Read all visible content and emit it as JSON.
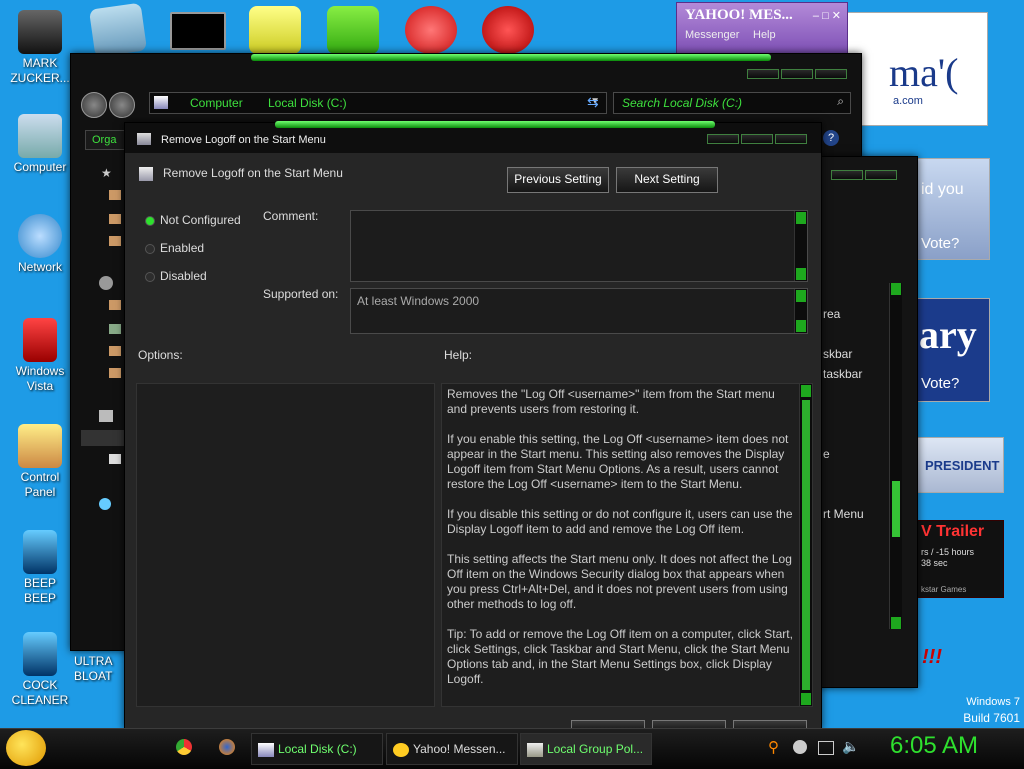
{
  "desktop": {
    "icons": [
      "MARK\nZUCKER...",
      "Computer",
      "Network",
      "Windows\nVista",
      "Control\nPanel",
      "BEEP\nBEEP",
      "COCK\nCLEANER"
    ],
    "partial_icon": "ULTRA\nBLOAT",
    "watermark": {
      "line1": "Windows 7",
      "line2": "Build 7601"
    }
  },
  "ads": {
    "obama": "ma'(",
    "obama_small": "a.com",
    "did_you": "id you",
    "vote1": "Vote?",
    "hillary": "ary",
    "vote2": "Vote?",
    "president": "PRESIDENT",
    "trailer": "V Trailer",
    "trailer_sub1": "rs / -15 hours",
    "trailer_sub2": "38 sec",
    "trailer_sub3": "kstar Games",
    "bangs": "!!!"
  },
  "yahoo": {
    "title": "YAHOO! MES...",
    "menu1": "Messenger",
    "menu2": "Help"
  },
  "explorer": {
    "crumb1": "Computer",
    "crumb2": "Local Disk (C:)",
    "search_placeholder": "Search Local Disk (C:)",
    "organize": "Orga"
  },
  "back_window": {
    "line1": "rea",
    "line2": "skbar",
    "line3": "taskbar",
    "line4": "e",
    "line5": "rt Menu"
  },
  "dialog": {
    "title": "Remove Logoff on the Start Menu",
    "setting_name": "Remove Logoff on the Start Menu",
    "prev_button": "Previous Setting",
    "next_button": "Next Setting",
    "radio_not_configured": "Not Configured",
    "radio_enabled": "Enabled",
    "radio_disabled": "Disabled",
    "comment_label": "Comment:",
    "supported_label": "Supported on:",
    "supported_value": "At least Windows 2000",
    "options_label": "Options:",
    "help_label": "Help:",
    "help_paragraphs": [
      "Removes the \"Log Off <username>\" item from the Start menu and prevents users from restoring it.",
      "If you enable this setting, the Log Off <username> item does not appear in the Start menu. This setting also removes the Display Logoff item from Start Menu Options. As a result, users cannot restore the Log Off <username> item to the Start Menu.",
      "If you disable this setting or do not configure it, users can use the Display Logoff item to add and remove the Log Off item.",
      "This setting affects the Start menu only. It does not affect the Log Off item on the Windows Security dialog box that appears when you press Ctrl+Alt+Del, and it does not prevent users from using other methods to log off.",
      "Tip: To add or remove the Log Off item on a computer, click Start, click Settings, click Taskbar and Start Menu, click the Start Menu Options tab and, in the Start Menu Settings box, click Display Logoff."
    ]
  },
  "taskbar": {
    "items": [
      "Local Disk (C:)",
      "Yahoo! Messen...",
      "Local Group Pol..."
    ],
    "clock": "6:05 AM"
  },
  "colors": {
    "desktop": "#1e9be6",
    "accent_green": "#2ee02e",
    "window_bg": "#111111"
  }
}
